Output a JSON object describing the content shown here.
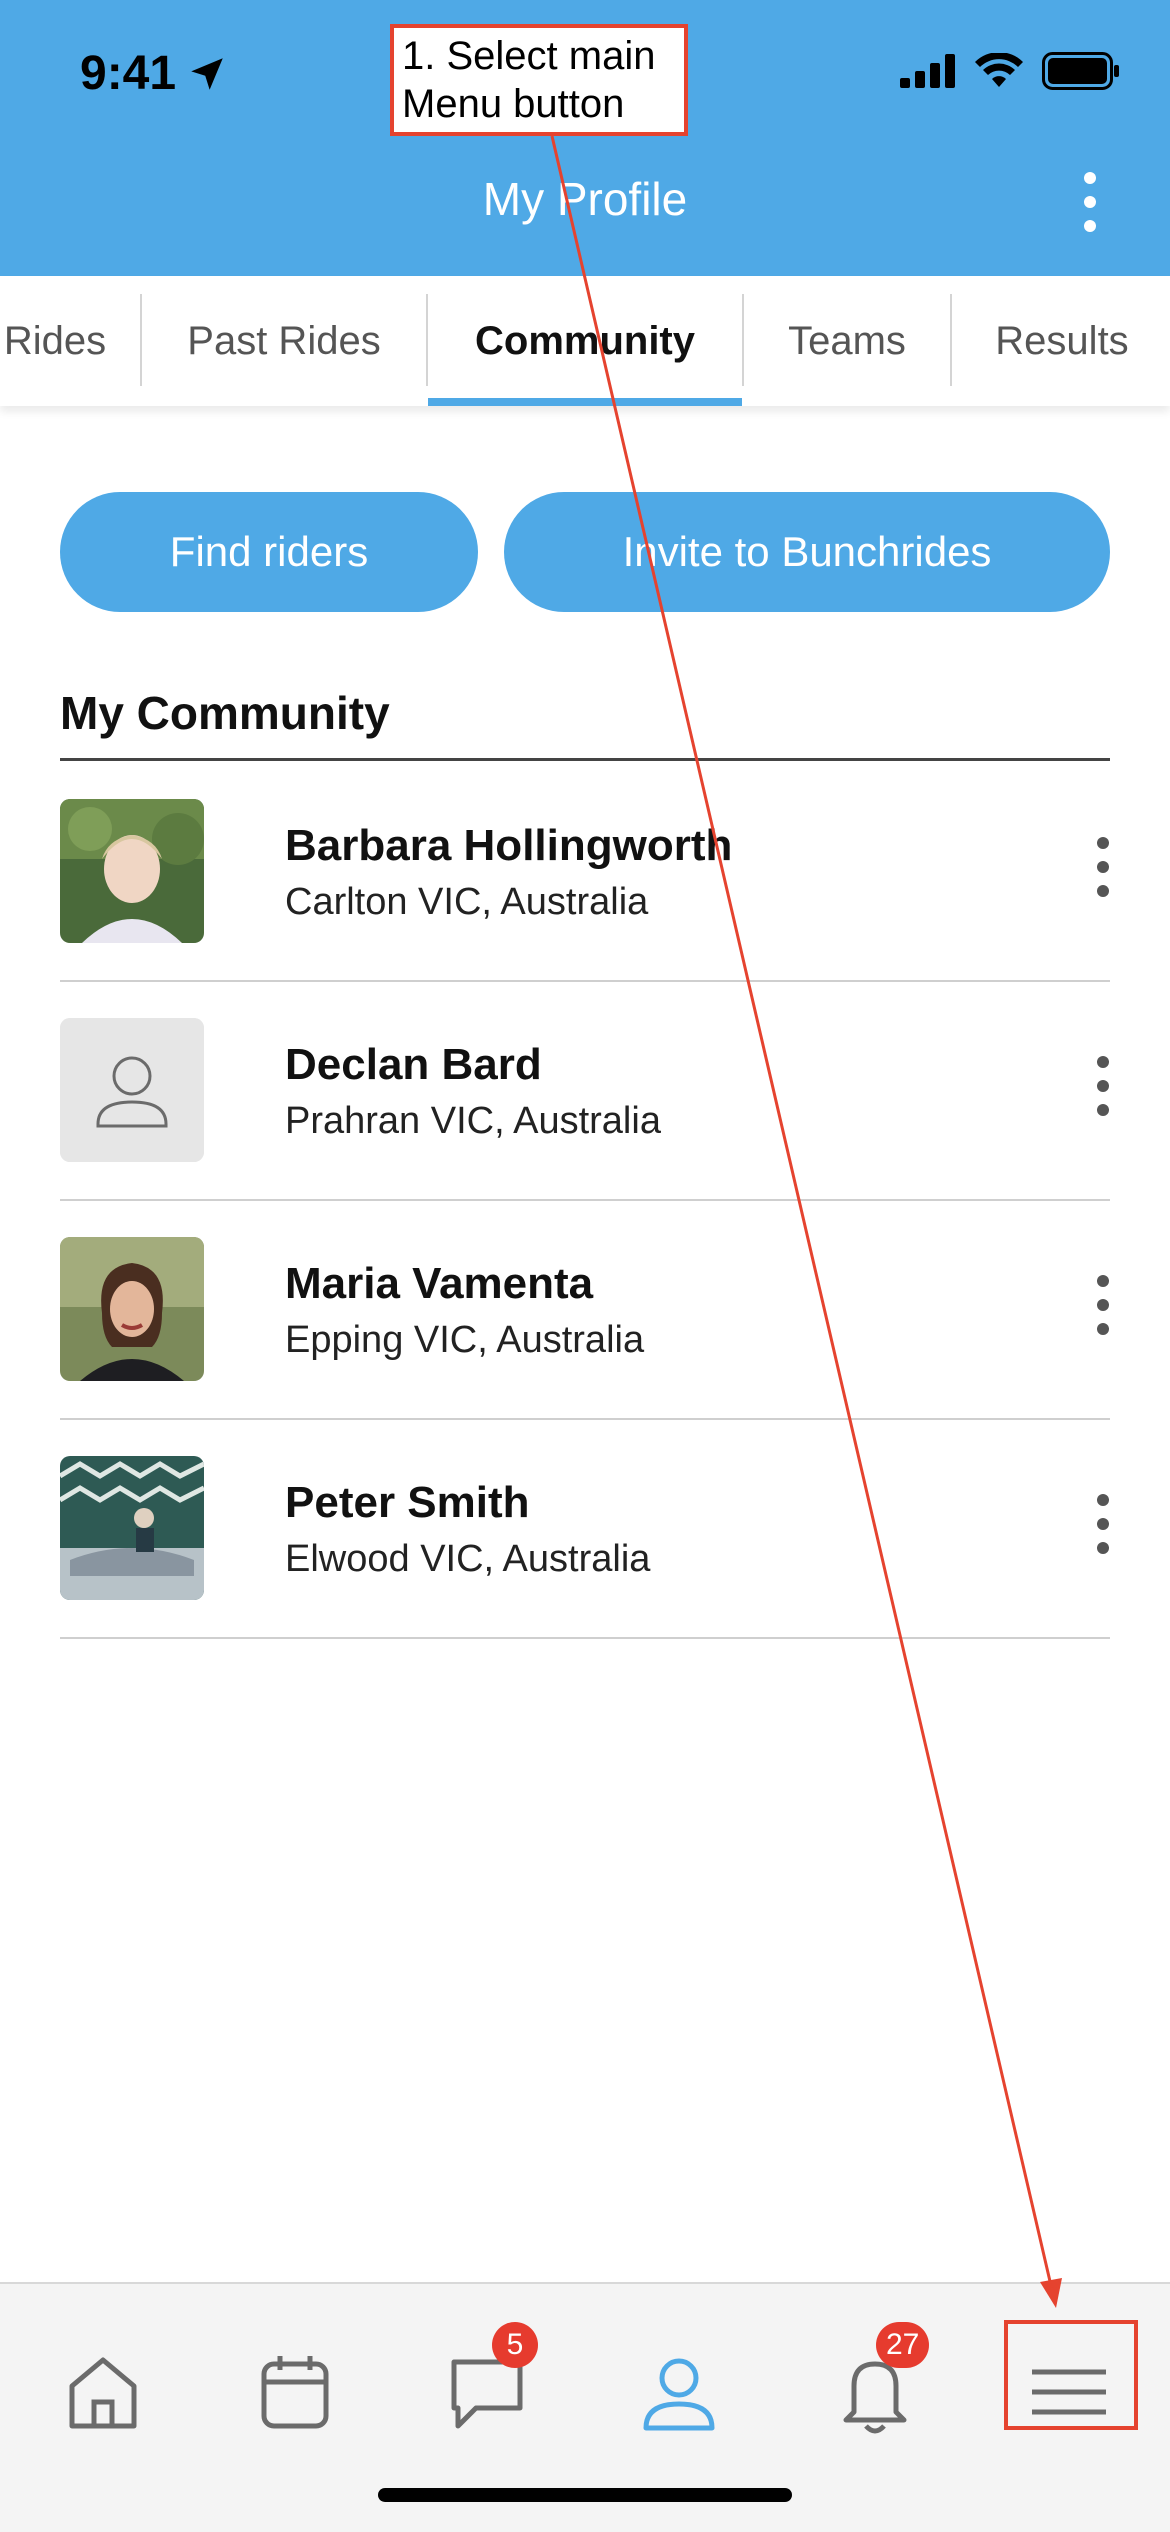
{
  "status_bar": {
    "time": "9:41",
    "icons": [
      "location-arrow-icon",
      "cellular-signal-icon",
      "wifi-icon",
      "battery-icon"
    ]
  },
  "header": {
    "title": "My Profile",
    "menu_icon": "more-vertical-icon"
  },
  "tabs": [
    {
      "label": "Rides",
      "active": false
    },
    {
      "label": "Past Rides",
      "active": false
    },
    {
      "label": "Community",
      "active": true
    },
    {
      "label": "Teams",
      "active": false
    },
    {
      "label": "Results",
      "active": false
    }
  ],
  "actions": {
    "find_riders": "Find riders",
    "invite": "Invite to Bunchrides"
  },
  "community": {
    "title": "My Community",
    "members": [
      {
        "name": "Barbara Hollingworth",
        "location": "Carlton VIC, Australia",
        "avatar": "photo"
      },
      {
        "name": "Declan Bard",
        "location": "Prahran VIC, Australia",
        "avatar": "placeholder-person-icon"
      },
      {
        "name": "Maria Vamenta",
        "location": "Epping VIC, Australia",
        "avatar": "photo"
      },
      {
        "name": "Peter Smith",
        "location": "Elwood VIC, Australia",
        "avatar": "photo"
      }
    ]
  },
  "bottom_nav": [
    {
      "icon": "home-icon",
      "active": false
    },
    {
      "icon": "calendar-icon",
      "active": false
    },
    {
      "icon": "chat-bubble-icon",
      "badge": "5",
      "active": false
    },
    {
      "icon": "profile-icon",
      "active": true
    },
    {
      "icon": "bell-icon",
      "badge": "27",
      "active": false
    },
    {
      "icon": "hamburger-menu-icon",
      "active": false
    }
  ],
  "annotation": {
    "text_line1": "1. Select main",
    "text_line2": "Menu button"
  },
  "colors": {
    "brand_blue": "#4fa9e6",
    "badge_red": "#e63b2e",
    "annotation_red": "#e5432f"
  }
}
